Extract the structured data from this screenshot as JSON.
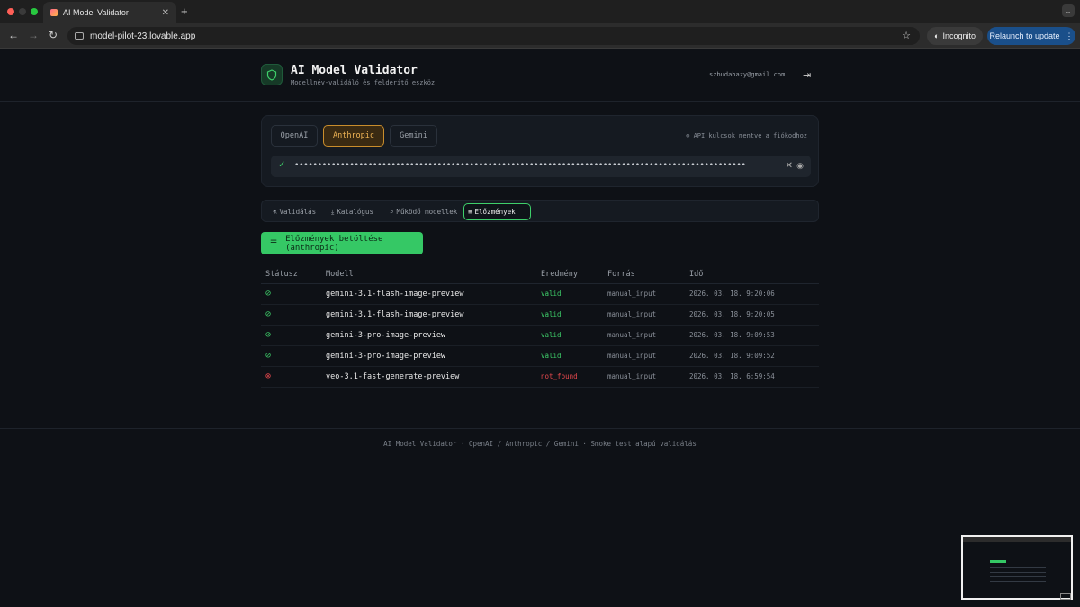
{
  "browser": {
    "tab_title": "AI Model Validator",
    "tab_close": "✕",
    "new_tab": "+",
    "url": "model-pilot-23.lovable.app",
    "incognito_label": "Incognito",
    "relaunch_label": "Relaunch to update",
    "relaunch_more": "⋮"
  },
  "header": {
    "title": "AI Model Validator",
    "subtitle": "Modellnév-validáló és felderítő eszköz",
    "email": "szbudahazy@gmail.com"
  },
  "providers": {
    "items": [
      "OpenAI",
      "Anthropic",
      "Gemini"
    ],
    "active": "Anthropic",
    "note": "API kulcsok mentve a fiókodhoz",
    "key_masked": "••••••••••••••••••••••••••••••••••••••••••••••••••••••••••••••••••••••••••••••••••••••••••••••••••"
  },
  "tabs": {
    "items": [
      "Validálás",
      "Katalógus",
      "Működő modellek",
      "Előzmények"
    ],
    "active": "Előzmények"
  },
  "load_button": "Előzmények betöltése (anthropic)",
  "history": {
    "headers": [
      "Státusz",
      "Modell",
      "Eredmény",
      "Forrás",
      "Idő"
    ],
    "rows": [
      {
        "status": "ok",
        "model": "gemini-3.1-flash-image-preview",
        "result": "valid",
        "source": "manual_input",
        "time": "2026. 03. 18. 9:20:06"
      },
      {
        "status": "ok",
        "model": "gemini-3.1-flash-image-preview",
        "result": "valid",
        "source": "manual_input",
        "time": "2026. 03. 18. 9:20:05"
      },
      {
        "status": "ok",
        "model": "gemini-3-pro-image-preview",
        "result": "valid",
        "source": "manual_input",
        "time": "2026. 03. 18. 9:09:53"
      },
      {
        "status": "ok",
        "model": "gemini-3-pro-image-preview",
        "result": "valid",
        "source": "manual_input",
        "time": "2026. 03. 18. 9:09:52"
      },
      {
        "status": "bad",
        "model": "veo-3.1-fast-generate-preview",
        "result": "not_found",
        "source": "manual_input",
        "time": "2026. 03. 18. 6:59:54"
      }
    ]
  },
  "footer": "AI Model Validator · OpenAI / Anthropic / Gemini · Smoke test alapú validálás",
  "colors": {
    "accent_green": "#35c865",
    "active_provider": "#f0b455",
    "error": "#e5484d"
  }
}
